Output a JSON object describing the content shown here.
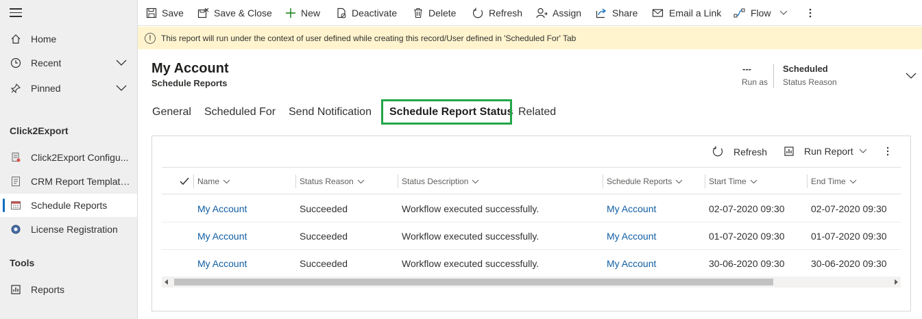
{
  "sidebar": {
    "items": [
      {
        "label": "Home",
        "icon": "home-icon"
      },
      {
        "label": "Recent",
        "icon": "clock-icon"
      },
      {
        "label": "Pinned",
        "icon": "pin-icon"
      }
    ],
    "groups": [
      {
        "header": "Click2Export",
        "items": [
          {
            "label": "Click2Export Configu...",
            "icon": "document-icon"
          },
          {
            "label": "CRM Report Templates",
            "icon": "template-icon"
          },
          {
            "label": "Schedule Reports",
            "icon": "calendar-icon",
            "selected": true
          },
          {
            "label": "License Registration",
            "icon": "license-icon"
          }
        ]
      },
      {
        "header": "Tools",
        "items": [
          {
            "label": "Reports",
            "icon": "reports-icon"
          }
        ]
      }
    ]
  },
  "toolbar": {
    "save": "Save",
    "save_close": "Save & Close",
    "new": "New",
    "deactivate": "Deactivate",
    "delete": "Delete",
    "refresh": "Refresh",
    "assign": "Assign",
    "share": "Share",
    "email_link": "Email a Link",
    "flow": "Flow"
  },
  "notification": "This report will run under the context of user defined while creating this record/User defined in 'Scheduled For' Tab",
  "record": {
    "title": "My Account",
    "entity": "Schedule Reports",
    "run_as_value": "---",
    "run_as_label": "Run as",
    "status_value": "Scheduled",
    "status_label": "Status Reason"
  },
  "tabs": [
    "General",
    "Scheduled For",
    "Send Notification",
    "Schedule Report Status",
    "Related"
  ],
  "active_tab": "Schedule Report Status",
  "subgrid": {
    "refresh": "Refresh",
    "run_report": "Run Report",
    "columns": [
      "Name",
      "Status Reason",
      "Status Description",
      "Schedule Reports",
      "Start Time",
      "End Time"
    ],
    "rows": [
      [
        "My Account",
        "Succeeded",
        "Workflow executed successfully.",
        "My Account",
        "02-07-2020 09:30",
        "02-07-2020 09:30"
      ],
      [
        "My Account",
        "Succeeded",
        "Workflow executed successfully.",
        "My Account",
        "01-07-2020 09:30",
        "01-07-2020 09:30"
      ],
      [
        "My Account",
        "Succeeded",
        "Workflow executed successfully.",
        "My Account",
        "30-06-2020 09:30",
        "30-06-2020 09:30"
      ]
    ]
  },
  "colors": {
    "highlight_box": "#22a648",
    "link": "#115ea3",
    "warning_bg": "#fff4ce",
    "selected_marker": "#0f6cbd"
  }
}
